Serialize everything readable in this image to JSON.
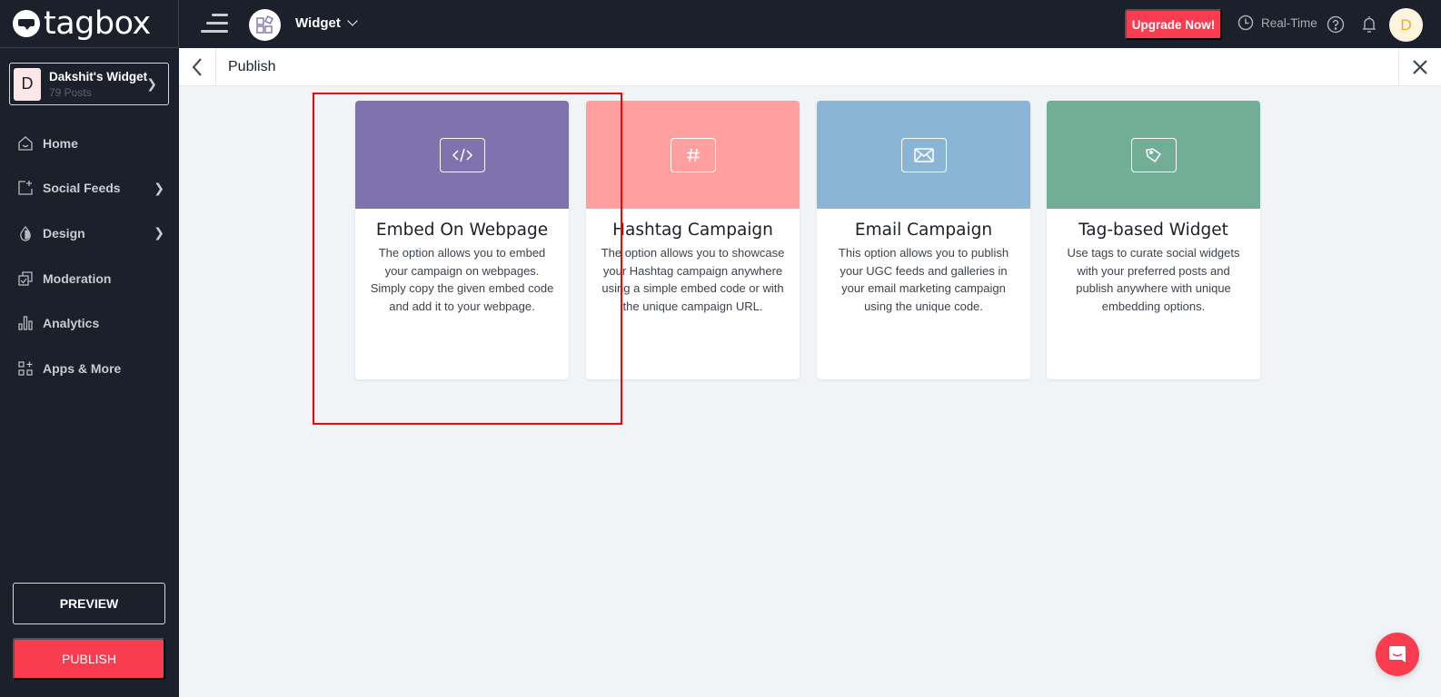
{
  "app": {
    "logo_text": "tagbox"
  },
  "sidebar": {
    "widget": {
      "avatar_letter": "D",
      "name": "Dakshit's Widget",
      "posts": "79 Posts"
    },
    "items": [
      {
        "label": "Home",
        "icon": "home-icon",
        "has_submenu": false
      },
      {
        "label": "Social Feeds",
        "icon": "add-feed-icon",
        "has_submenu": true
      },
      {
        "label": "Design",
        "icon": "droplet-icon",
        "has_submenu": true
      },
      {
        "label": "Moderation",
        "icon": "moderation-icon",
        "has_submenu": false
      },
      {
        "label": "Analytics",
        "icon": "bar-chart-icon",
        "has_submenu": false
      },
      {
        "label": "Apps & More",
        "icon": "apps-icon",
        "has_submenu": false
      }
    ],
    "preview_label": "PREVIEW",
    "publish_label": "PUBLISH"
  },
  "topbar": {
    "widget_label": "Widget",
    "upgrade_label": "Upgrade Now!",
    "realtime_label": "Real-Time",
    "user_initial": "D"
  },
  "subheader": {
    "title": "Publish"
  },
  "cards": [
    {
      "title": "Embed On Webpage",
      "description": "The option allows you to embed your campaign on webpages. Simply copy the given embed code and add it to your webpage.",
      "icon": "code-icon",
      "color": "#7f73ae"
    },
    {
      "title": "Hashtag Campaign",
      "description": "The option allows you to showcase your Hashtag campaign anywhere using a simple embed code or with the unique campaign URL.",
      "icon": "hashtag-icon",
      "color": "#ff9fa0"
    },
    {
      "title": "Email Campaign",
      "description": "This option allows you to publish your UGC feeds and galleries in your email marketing campaign using the unique code.",
      "icon": "envelope-icon",
      "color": "#8bb5d5"
    },
    {
      "title": "Tag-based Widget",
      "description": "Use tags to curate social widgets with your preferred posts and publish anywhere with unique embedding options.",
      "icon": "tag-icon",
      "color": "#71ad97"
    }
  ],
  "colors": {
    "brand_red": "#fa3c50",
    "sidebar_bg": "#1b202a",
    "highlight": "#ff0000"
  }
}
